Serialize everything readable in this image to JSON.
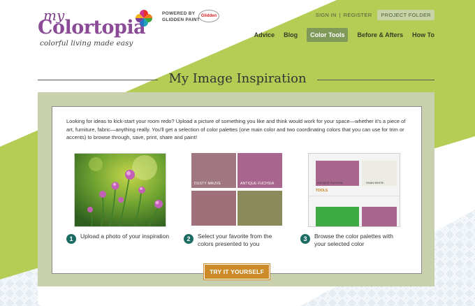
{
  "brand": {
    "logo_prefix": "my",
    "logo_name": "Colortopia",
    "tagline": "colorful living made easy",
    "powered_by": "POWERED BY\nGLIDDEN PAINT",
    "partner_logo": "Glidden"
  },
  "utility_nav": {
    "sign_in": "SIGN IN",
    "separator": "|",
    "register": "REGISTER",
    "project_folder": "PROJECT FOLDER"
  },
  "main_nav": {
    "items": [
      {
        "label": "Advice"
      },
      {
        "label": "Blog"
      },
      {
        "label": "Color Tools",
        "active": true
      },
      {
        "label": "Before & Afters"
      },
      {
        "label": "How To"
      }
    ]
  },
  "page": {
    "title": "My Image Inspiration",
    "intro": "Looking for ideas to kick-start your room redo? Upload a picture of something you like and think would work for your space—whether it's a piece of art, furniture, fabric—anything really. You'll get a selection of color palettes (one main color and two coordinating colors that you can use for trim or accents) to browse through, save, print, share and paint!"
  },
  "steps": [
    {
      "number": "1",
      "text": "Upload a photo of your inspiration",
      "icon": "flower-photo"
    },
    {
      "number": "2",
      "text": "Select your favorite from the colors presented to you",
      "icon": "color-swatches"
    },
    {
      "number": "3",
      "text": "Browse the color palettes with your selected color",
      "icon": "palette-preview"
    }
  ],
  "swatches": [
    {
      "name": "DUSTY MAUVE",
      "color": "#a07680"
    },
    {
      "name": "ANTIQUE FUCHSIA",
      "color": "#a8668e"
    },
    {
      "name": "",
      "color": "#a0707a"
    },
    {
      "name": "",
      "color": "#8a8a5a"
    }
  ],
  "palette_preview": {
    "main_label": "ANTIQUE FUCHSIA",
    "second_label": "SHAN WHITE",
    "tools_label": "TOOLS",
    "colors": {
      "fuchsia": "#a8668e",
      "white": "#ecece4",
      "green": "#3daa44"
    }
  },
  "cta": {
    "label": "TRY IT YOURSELF"
  },
  "colors": {
    "accent_green": "#b5cc55",
    "nav_active": "#7f9a58",
    "step_badge": "#1b6d64",
    "cta": "#cc8a28"
  }
}
